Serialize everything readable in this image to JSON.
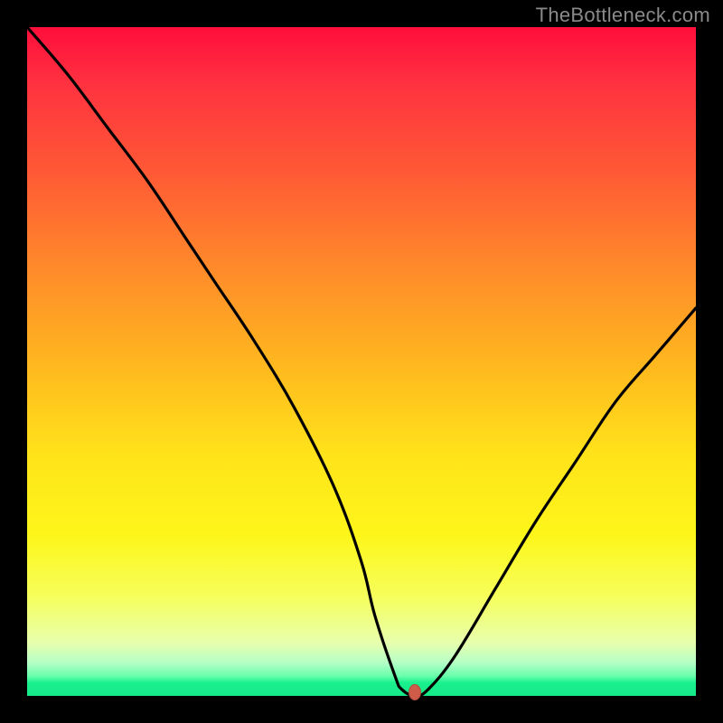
{
  "watermark": "TheBottleneck.com",
  "chart_data": {
    "type": "line",
    "title": "",
    "xlabel": "",
    "ylabel": "",
    "xlim": [
      0,
      100
    ],
    "ylim": [
      0,
      100
    ],
    "background": {
      "gradient": "vertical",
      "stops": [
        {
          "pos": 0,
          "color": "#ff0e3b"
        },
        {
          "pos": 50,
          "color": "#ffb61f"
        },
        {
          "pos": 76,
          "color": "#fdf61a"
        },
        {
          "pos": 95,
          "color": "#b7ffc6"
        },
        {
          "pos": 100,
          "color": "#14e888"
        }
      ]
    },
    "series": [
      {
        "name": "bottleneck-curve",
        "color": "#000000",
        "x": [
          0,
          6,
          12,
          18,
          24,
          28,
          34,
          40,
          46,
          50,
          52,
          55,
          56,
          58,
          60,
          64,
          70,
          76,
          82,
          88,
          94,
          100
        ],
        "y": [
          100,
          93,
          85,
          77,
          68,
          62,
          53,
          43,
          31,
          20,
          12,
          3,
          1,
          0,
          1,
          6,
          16,
          26,
          35,
          44,
          51,
          58
        ]
      }
    ],
    "marker": {
      "x": 58,
      "y": 0.5,
      "color": "#cf5b49"
    }
  }
}
